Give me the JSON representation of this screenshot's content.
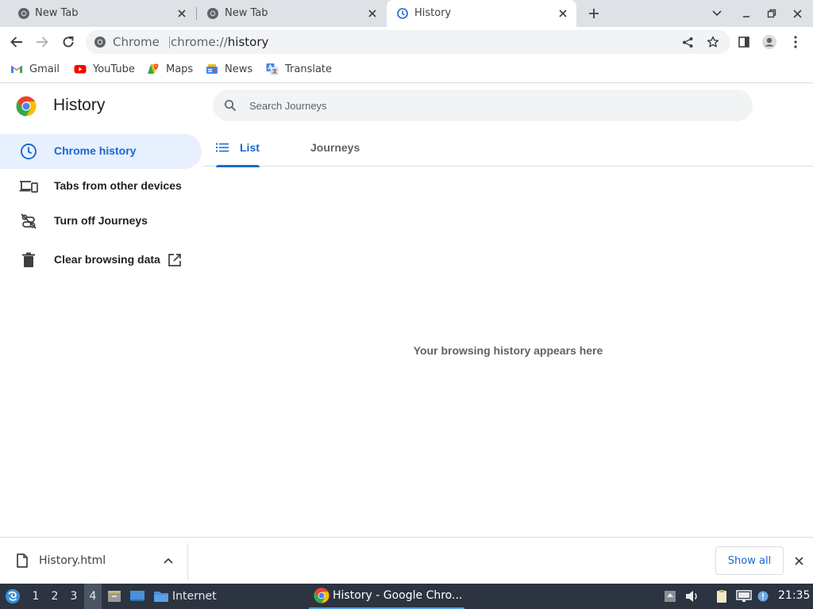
{
  "browser": {
    "tabs": [
      {
        "title": "New Tab",
        "active": false
      },
      {
        "title": "New Tab",
        "active": false
      },
      {
        "title": "History",
        "active": true
      }
    ],
    "omnibox": {
      "chip": "Chrome",
      "url_scheme": "chrome://",
      "url_host": "history"
    },
    "bookmarks": [
      {
        "label": "Gmail",
        "icon": "gmail-icon"
      },
      {
        "label": "YouTube",
        "icon": "youtube-icon"
      },
      {
        "label": "Maps",
        "icon": "maps-icon"
      },
      {
        "label": "News",
        "icon": "news-icon"
      },
      {
        "label": "Translate",
        "icon": "translate-icon"
      }
    ]
  },
  "page": {
    "title": "History",
    "search_placeholder": "Search Journeys",
    "sidebar": [
      {
        "label": "Chrome history",
        "icon": "clock-icon",
        "active": true
      },
      {
        "label": "Tabs from other devices",
        "icon": "devices-icon",
        "active": false
      },
      {
        "label": "Turn off Journeys",
        "icon": "journeys-off-icon",
        "active": false
      },
      {
        "label": "Clear browsing data",
        "icon": "trash-icon",
        "active": false
      }
    ],
    "tabs": [
      {
        "label": "List",
        "active": true
      },
      {
        "label": "Journeys",
        "active": false
      }
    ],
    "empty_message": "Your browsing history appears here"
  },
  "download_shelf": {
    "filename": "History.html",
    "show_all_label": "Show all"
  },
  "taskbar": {
    "workspaces": [
      "1",
      "2",
      "3",
      "4"
    ],
    "active_workspace": "4",
    "launcher_label": "Internet",
    "window_title": "History - Google Chro...",
    "clock": "21:35"
  },
  "colors": {
    "accent": "#1967d2",
    "active_bg": "#e8f0fe",
    "tabstrip": "#dee1e6",
    "taskbar": "#2b3440"
  }
}
